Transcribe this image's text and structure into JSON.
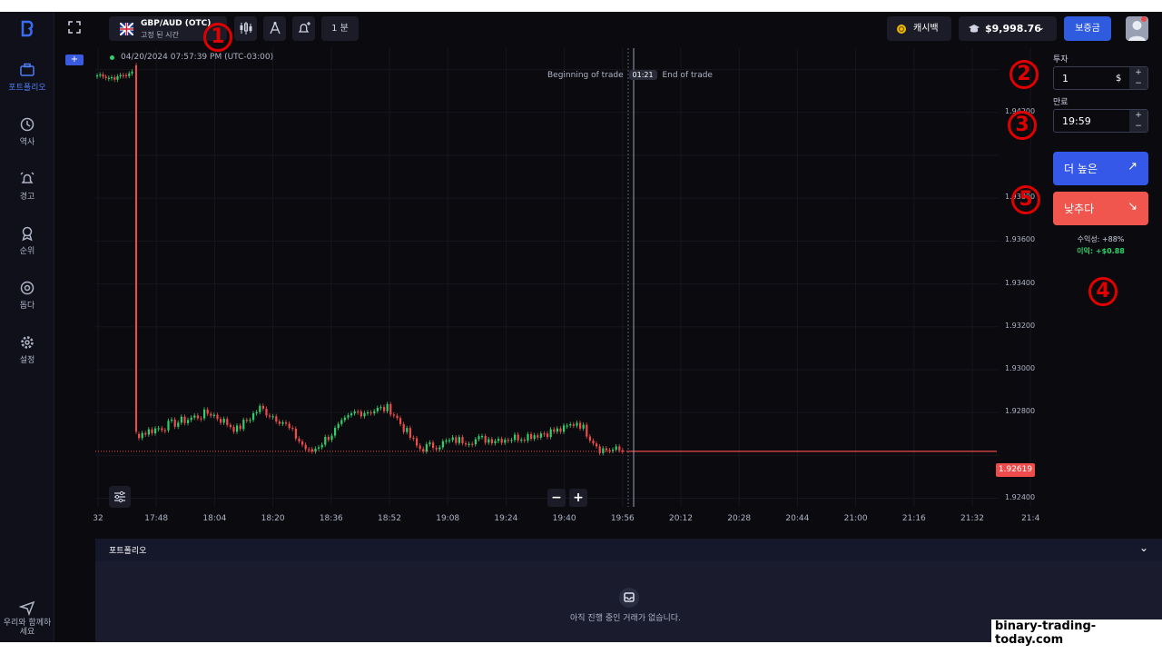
{
  "sidebar": {
    "items": [
      {
        "label": "포트폴리오",
        "icon": "briefcase-icon",
        "active": true
      },
      {
        "label": "역사",
        "icon": "history-icon"
      },
      {
        "label": "경고",
        "icon": "alarm-icon"
      },
      {
        "label": "순위",
        "icon": "ranking-icon"
      },
      {
        "label": "돕다",
        "icon": "help-icon"
      },
      {
        "label": "설정",
        "icon": "settings-icon"
      }
    ],
    "bottom_label_line1": "우리와 함께하",
    "bottom_label_line2": "세요"
  },
  "topbar": {
    "asset_name": "GBP/AUD (OTC)",
    "asset_sub": "고정 된 시간",
    "timeframe": "1 분",
    "cashback": "캐시백",
    "balance": "$9,998.76",
    "deposit": "보증금"
  },
  "chart": {
    "datetime": "04/20/2024  07:57:39 PM (UTC-03:00)",
    "beginning_label": "Beginning of trade",
    "timer": "01:21",
    "end_label": "End of trade",
    "current_price": "1.92619",
    "x_ticks": [
      "32",
      "17:48",
      "18:04",
      "18:20",
      "18:36",
      "18:52",
      "19:08",
      "19:24",
      "19:40",
      "19:56",
      "20:12",
      "20:28",
      "20:44",
      "21:00",
      "21:16",
      "21:32",
      "21:4"
    ],
    "y_ticks": [
      "1.94400",
      "1.94200",
      "1.94000",
      "1.93800",
      "1.93600",
      "1.93400",
      "1.93200",
      "1.93000",
      "1.92800",
      "1.92600",
      "1.92400"
    ],
    "y_tick_labels_shown": [
      "",
      "1.94200",
      "",
      "1.93800",
      "1.93600",
      "1.93400",
      "1.93200",
      "1.93000",
      "1.92800",
      "",
      "1.92400"
    ]
  },
  "chart_data": {
    "type": "candlestick",
    "title": "GBP/AUD (OTC)",
    "x_range": [
      "17:32",
      "21:40"
    ],
    "ylim": [
      1.9236,
      1.945
    ],
    "current_price": 1.92619,
    "trade_expiry_x": "19:57",
    "segments": [
      {
        "from": "17:33",
        "to": "17:42",
        "start": 1.9437,
        "end": 1.9442
      },
      {
        "from": "17:42",
        "to": "17:43",
        "start": 1.9442,
        "end": 1.9271,
        "note": "sharp drop"
      },
      {
        "from": "17:43",
        "to": "19:57",
        "range": [
          1.9261,
          1.9283
        ]
      }
    ]
  },
  "panel": {
    "invest_label": "투자",
    "invest_value": "1",
    "invest_unit": "$",
    "expiry_label": "만료",
    "expiry_value": "19:59",
    "higher_label": "더 높은",
    "lower_label": "낮추다",
    "payout": "수익성: +88%",
    "profit": "이익: +$0.88"
  },
  "annotations": [
    "1",
    "2",
    "3",
    "4",
    "5"
  ],
  "portfolio": {
    "title": "포트폴리오",
    "empty_text": "아직 진행 중인 거래가 없습니다."
  },
  "watermark": "binary-trading-today.com",
  "colors": {
    "up": "#2fd06a",
    "down": "#ef4b4b",
    "accent": "#3558e8"
  }
}
